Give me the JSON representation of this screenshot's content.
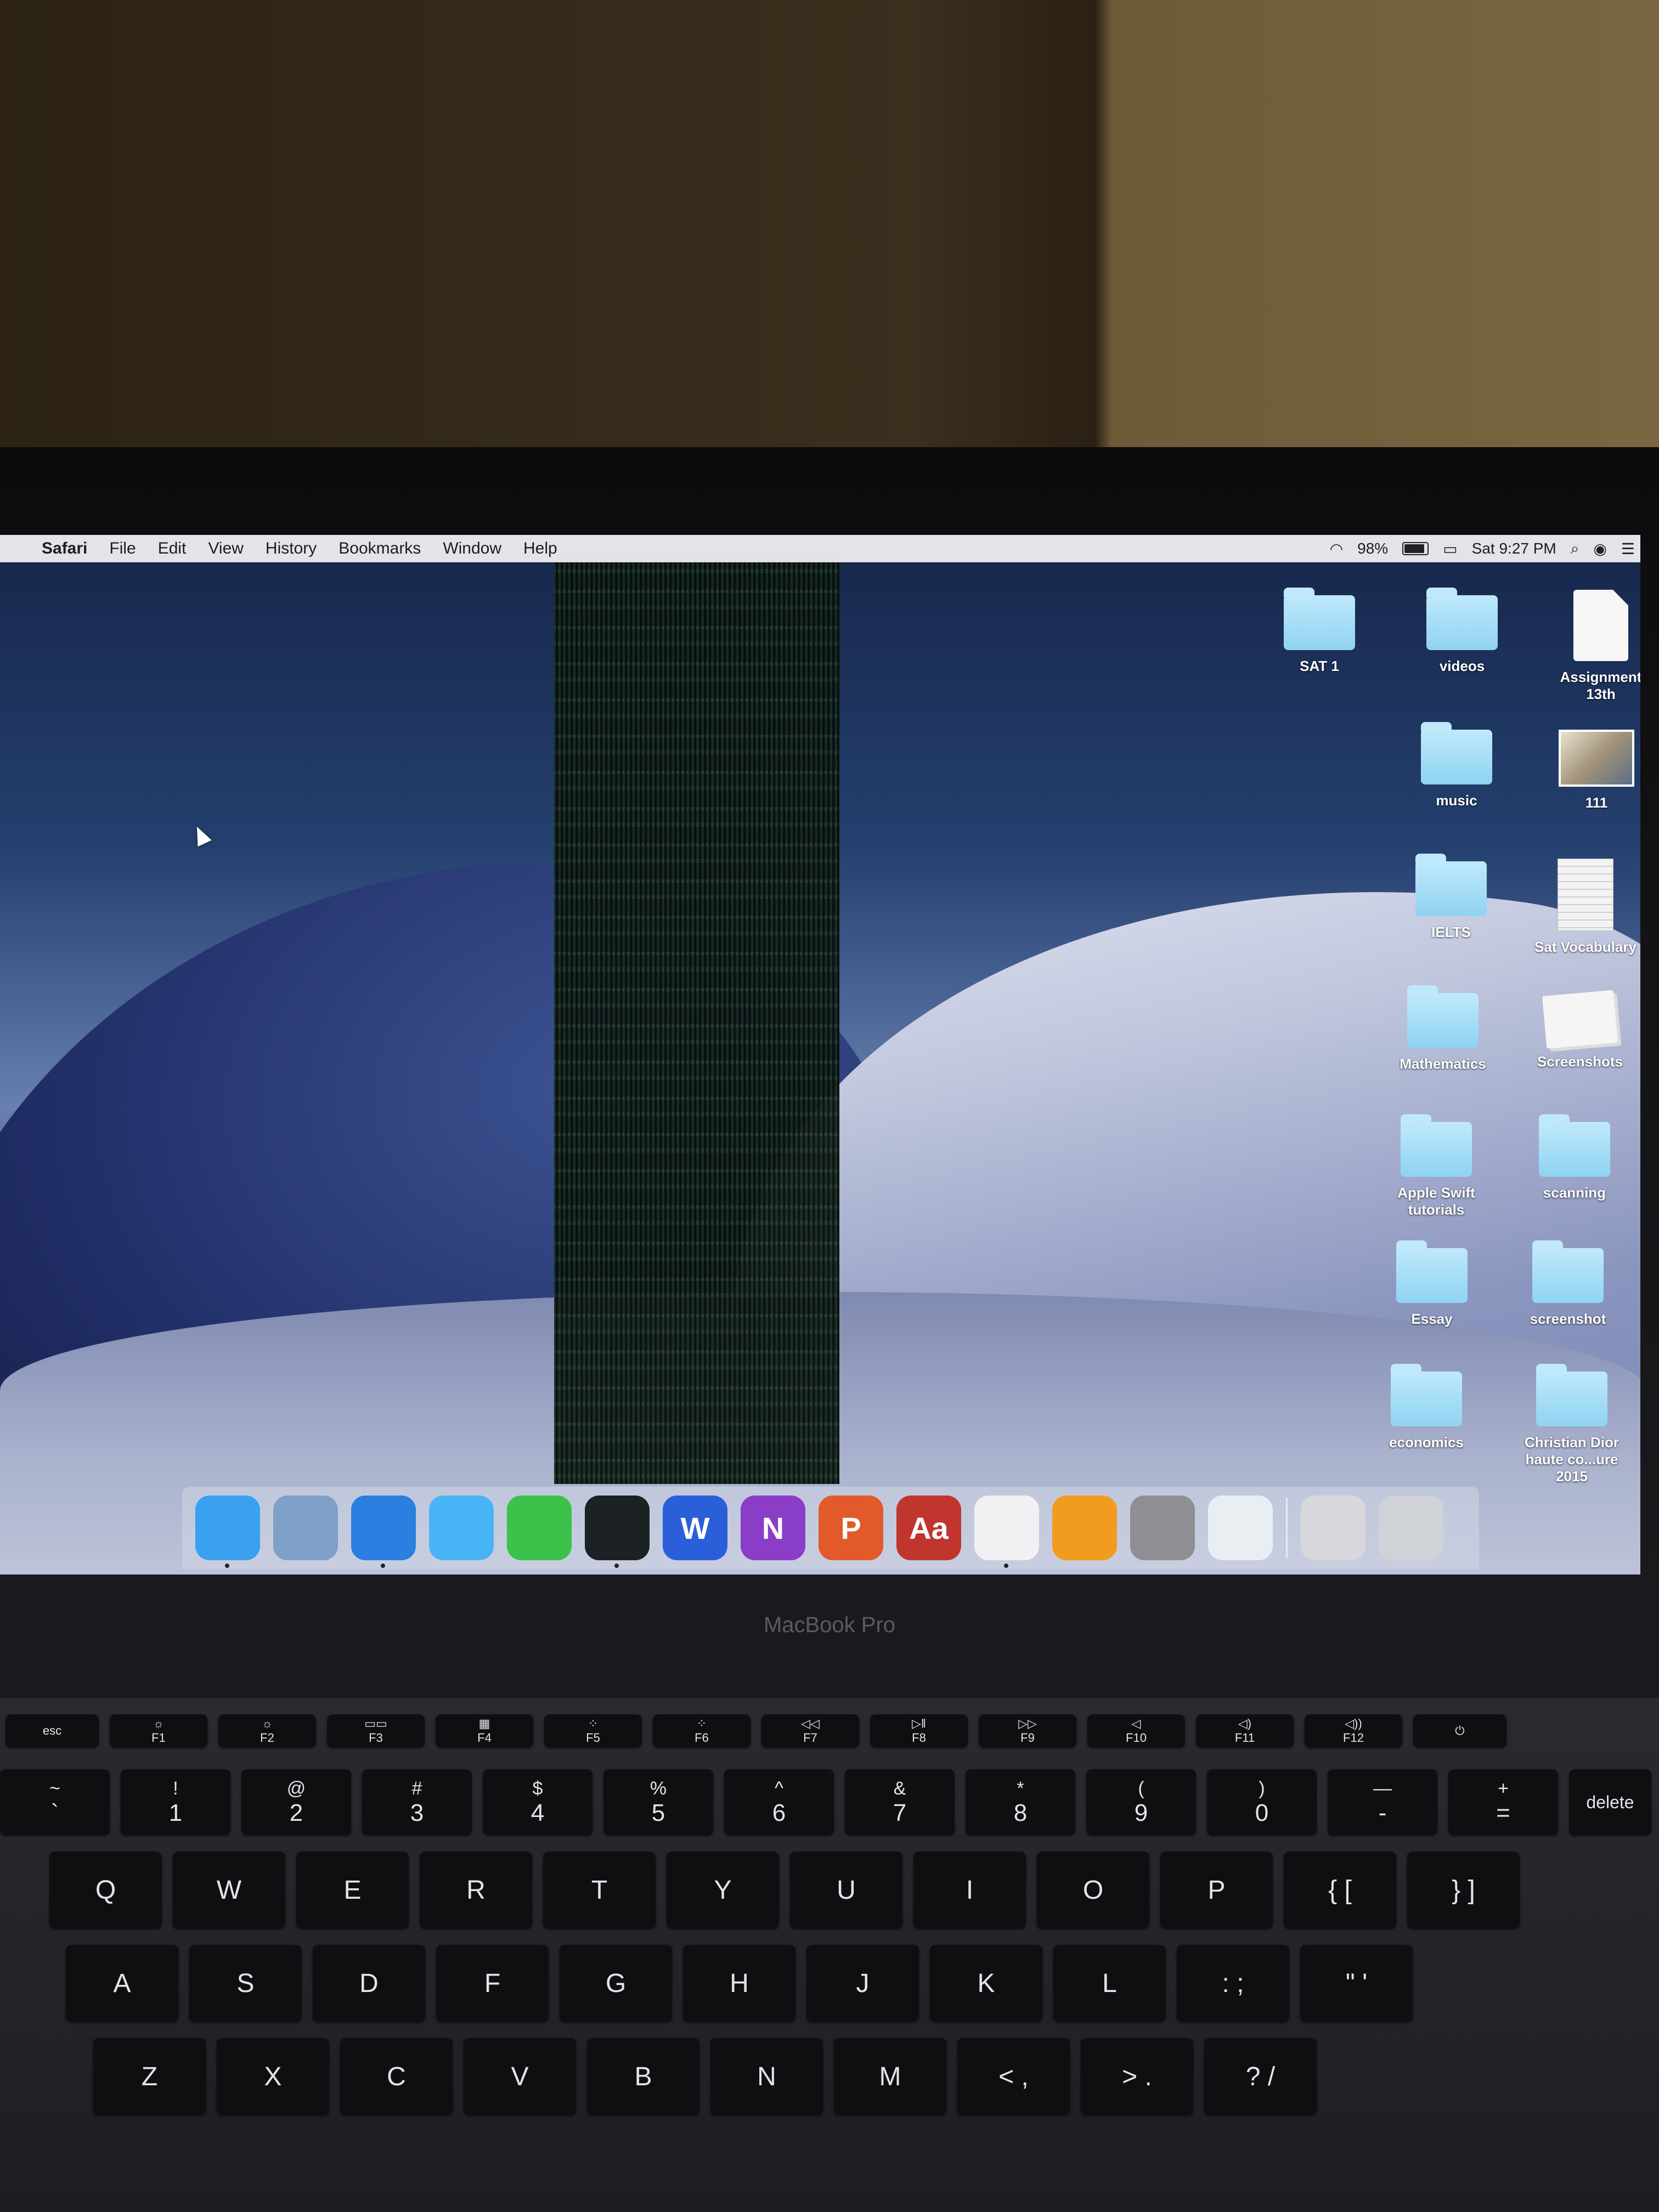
{
  "menubar": {
    "app_name": "Safari",
    "items": [
      "File",
      "Edit",
      "View",
      "History",
      "Bookmarks",
      "Window",
      "Help"
    ],
    "battery": "98%",
    "clock": "Sat 9:27 PM"
  },
  "desktop_icons": [
    {
      "label": "SAT 1",
      "kind": "folder"
    },
    {
      "label": "videos",
      "kind": "folder"
    },
    {
      "label": "Assignment 13th",
      "kind": "document"
    },
    {
      "label": "music",
      "kind": "folder"
    },
    {
      "label": "111",
      "kind": "image"
    },
    {
      "label": "IELTS",
      "kind": "folder"
    },
    {
      "label": "Sat Vocabulary",
      "kind": "document"
    },
    {
      "label": "Mathematics",
      "kind": "folder"
    },
    {
      "label": "Screenshots",
      "kind": "stack"
    },
    {
      "label": "Apple Swift tutorials",
      "kind": "folder"
    },
    {
      "label": "scanning",
      "kind": "folder"
    },
    {
      "label": "Essay",
      "kind": "folder"
    },
    {
      "label": "screenshot",
      "kind": "folder"
    },
    {
      "label": "economics",
      "kind": "folder"
    },
    {
      "label": "Christian Dior haute co...ure 2015",
      "kind": "folder"
    }
  ],
  "dock": {
    "apps": [
      {
        "name": "finder-icon",
        "glyph": "",
        "color": "#3aa0f0",
        "running": true
      },
      {
        "name": "mail-icon",
        "glyph": "",
        "color": "#7fa0c8",
        "running": false
      },
      {
        "name": "safari-icon",
        "glyph": "",
        "color": "#2a7fe0",
        "running": true
      },
      {
        "name": "messages-icon",
        "glyph": "",
        "color": "#47b5f5",
        "running": false
      },
      {
        "name": "facetime-icon",
        "glyph": "",
        "color": "#3ac24a",
        "running": false
      },
      {
        "name": "activity-monitor-icon",
        "glyph": "",
        "color": "#1c2124",
        "running": true
      },
      {
        "name": "word-icon",
        "glyph": "W",
        "color": "#2b5fd9",
        "running": false
      },
      {
        "name": "onenote-icon",
        "glyph": "N",
        "color": "#8a3dc6",
        "running": false
      },
      {
        "name": "powerpoint-icon",
        "glyph": "P",
        "color": "#e25a2a",
        "running": false
      },
      {
        "name": "dictionary-icon",
        "glyph": "Aa",
        "color": "#c0352d",
        "running": false
      },
      {
        "name": "itunes-icon",
        "glyph": "",
        "color": "#f1f1f4",
        "running": true
      },
      {
        "name": "ibooks-icon",
        "glyph": "",
        "color": "#f29c1f",
        "running": false
      },
      {
        "name": "system-preferences-icon",
        "glyph": "",
        "color": "#8e8e93",
        "running": false
      },
      {
        "name": "stethoscope-icon",
        "glyph": "",
        "color": "#e9eef3",
        "running": false
      }
    ],
    "stacks": [
      {
        "name": "downloads-stack-icon",
        "color": "#d8d8dc"
      },
      {
        "name": "trash-icon",
        "color": "#cfd3d8"
      }
    ]
  },
  "laptop": {
    "model": "MacBook Pro"
  },
  "keyboard": {
    "function_row": [
      {
        "label": "esc",
        "sub": ""
      },
      {
        "label": "☼",
        "sub": "F1"
      },
      {
        "label": "☼",
        "sub": "F2"
      },
      {
        "label": "▭▭",
        "sub": "F3"
      },
      {
        "label": "▦",
        "sub": "F4"
      },
      {
        "label": "⁘",
        "sub": "F5"
      },
      {
        "label": "⁘",
        "sub": "F6"
      },
      {
        "label": "◁◁",
        "sub": "F7"
      },
      {
        "label": "▷‖",
        "sub": "F8"
      },
      {
        "label": "▷▷",
        "sub": "F9"
      },
      {
        "label": "◁",
        "sub": "F10"
      },
      {
        "label": "◁)",
        "sub": "F11"
      },
      {
        "label": "◁))",
        "sub": "F12"
      },
      {
        "label": "⏻",
        "sub": ""
      }
    ],
    "number_row": [
      {
        "top": "~",
        "bot": "`"
      },
      {
        "top": "!",
        "bot": "1"
      },
      {
        "top": "@",
        "bot": "2"
      },
      {
        "top": "#",
        "bot": "3"
      },
      {
        "top": "$",
        "bot": "4"
      },
      {
        "top": "%",
        "bot": "5"
      },
      {
        "top": "^",
        "bot": "6"
      },
      {
        "top": "&",
        "bot": "7"
      },
      {
        "top": "*",
        "bot": "8"
      },
      {
        "top": "(",
        "bot": "9"
      },
      {
        "top": ")",
        "bot": "0"
      },
      {
        "top": "—",
        "bot": "-"
      },
      {
        "top": "+",
        "bot": "="
      },
      {
        "top": "",
        "bot": "delete"
      }
    ],
    "row_q": [
      "Q",
      "W",
      "E",
      "R",
      "T",
      "Y",
      "U",
      "I",
      "O",
      "P",
      "{ [",
      "} ]"
    ],
    "row_a": [
      "A",
      "S",
      "D",
      "F",
      "G",
      "H",
      "J",
      "K",
      "L",
      ": ;",
      "\" '"
    ],
    "row_z": [
      "Z",
      "X",
      "C",
      "V",
      "B",
      "N",
      "M",
      "< ,",
      "> .",
      "? /"
    ]
  }
}
